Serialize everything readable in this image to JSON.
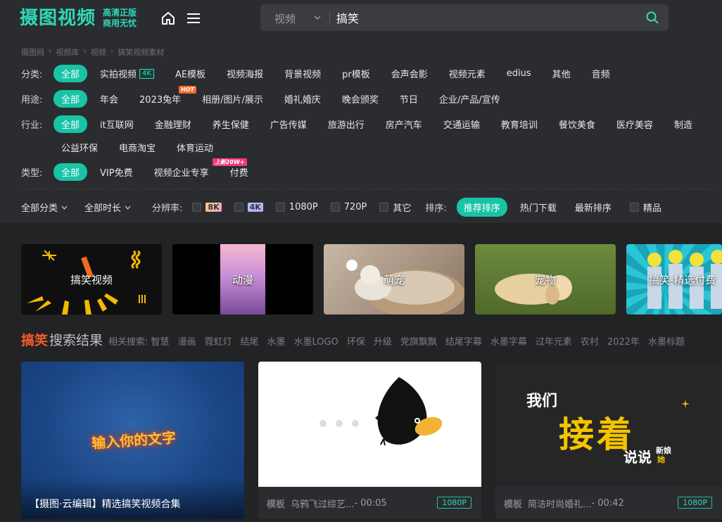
{
  "header": {
    "logo": "摄图视频",
    "slogan_line1": "高清正版",
    "slogan_line2": "商用无忧",
    "search": {
      "category": "视频",
      "query": "搞笑"
    }
  },
  "breadcrumb": [
    "摄图网",
    "视频库",
    "视频",
    "搞笑视频素材"
  ],
  "filters": {
    "category": {
      "label": "分类:",
      "items": [
        "全部",
        "实拍视频",
        "AE模板",
        "视频海报",
        "背景视频",
        "pr模板",
        "会声会影",
        "视频元素",
        "edius",
        "其他",
        "音频"
      ],
      "tag4k": "4K"
    },
    "usage": {
      "label": "用途:",
      "items": [
        "全部",
        "年会",
        "2023兔年",
        "相册/图片/展示",
        "婚礼婚庆",
        "晚会颁奖",
        "节日",
        "企业/产品/宣传"
      ],
      "hot": "HOT"
    },
    "industry": {
      "label": "行业:",
      "items": [
        "全部",
        "it互联网",
        "金融理财",
        "养生保健",
        "广告传媒",
        "旅游出行",
        "房产汽车",
        "交通运输",
        "教育培训",
        "餐饮美食",
        "医疗美容",
        "制造"
      ],
      "items_row2": [
        "公益环保",
        "电商淘宝",
        "体育运动"
      ]
    },
    "type": {
      "label": "类型:",
      "items": [
        "全部",
        "VIP免费",
        "视频企业专享",
        "付费"
      ],
      "new_tag": "上新20W+"
    }
  },
  "sortbar": {
    "all_categories": "全部分类",
    "all_durations": "全部时长",
    "resolution_label": "分辨率:",
    "resolutions": [
      "8K",
      "4K",
      "1080P",
      "720P",
      "其它"
    ],
    "sort_label": "排序:",
    "sorts": [
      "推荐排序",
      "热门下载",
      "最新排序"
    ],
    "premium": "精品"
  },
  "category_cards": [
    "搞笑视频",
    "动漫",
    "萌宠",
    "宠物",
    "搞笑-精选付费"
  ],
  "results": {
    "keyword": "搞笑",
    "title": "搜索结果",
    "related_label": "相关搜索:",
    "related": [
      "智慧",
      "漫画",
      "霓虹灯",
      "结尾",
      "水墨",
      "水墨LOGO",
      "环保",
      "升级",
      "党旗飘飘",
      "结尾字幕",
      "水墨字幕",
      "过年元素",
      "农村",
      "2022年",
      "水墨标题"
    ]
  },
  "videos": [
    {
      "title": "【摄图·云编辑】精选搞笑视频合集",
      "overlay_text": "输入你的文字"
    },
    {
      "type": "模板",
      "name": "乌鸦飞过综艺...",
      "duration": " - 00:05",
      "resolution": "1080P"
    },
    {
      "type": "模板",
      "name": "简洁时尚婚礼...",
      "duration": " - 00:42",
      "resolution": "1080P",
      "poster_line1": "我们",
      "poster_line2": "接着",
      "poster_line3": "说说",
      "poster_side1": "新娘",
      "poster_side2": "她"
    }
  ],
  "colors": {
    "accent": "#19c3a6",
    "keyword": "#f45c2b",
    "hot": "#f36c2a",
    "new": "#f13b7a"
  }
}
